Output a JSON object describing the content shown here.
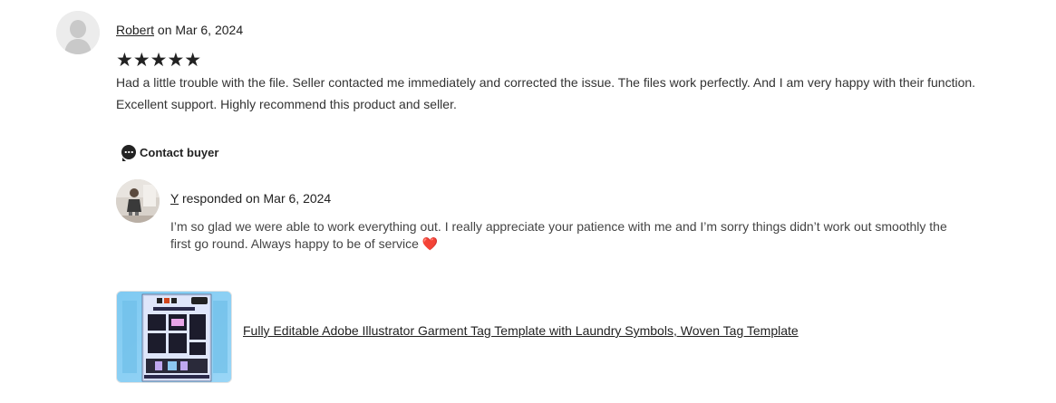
{
  "review": {
    "reviewer_name": "Robert",
    "date_prefix": " on ",
    "date": "Mar 6, 2024",
    "stars": "★★★★★",
    "rating": 5,
    "text": "Had a little trouble with the file. Seller contacted me immediately and corrected the issue. The files work perfectly. And I am very happy with their function. Excellent support. Highly recommend this product and seller."
  },
  "contact": {
    "label": "Contact buyer",
    "icon": "chat-bubble-icon"
  },
  "response": {
    "seller_name": "Y",
    "responded_text": " responded on ",
    "date": "Mar 6, 2024",
    "text": "I’m so glad we were able to work everything out. I really appreciate your patience with me and I’m sorry things didn’t work out smoothly the first go round. Always happy to be of service",
    "emoji": "❤️"
  },
  "product": {
    "title": "Fully Editable Adobe Illustrator Garment Tag Template with Laundry Symbols, Woven Tag Template",
    "thumb_heading": "WOVEN TAG TEMPLATE"
  },
  "colors": {
    "text": "#222222",
    "muted": "#444444",
    "heart": "#e0243a",
    "thumb_bg": "#8fd0f5"
  }
}
